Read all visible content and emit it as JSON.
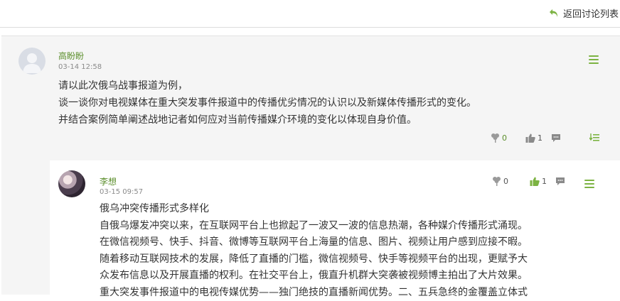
{
  "header": {
    "back_label": "返回讨论列表"
  },
  "post": {
    "author": "高盼盼",
    "time": "03-14 12:58",
    "lines": [
      "请以此次俄乌战事报道为例，",
      "谈一谈你对电视媒体在重大突发事件报道中的传播优劣情况的认识以及新媒体传播形式的变化。",
      "并结合案例简单阐述战地记者如何应对当前传播媒介环境的变化以体现自身价值。"
    ],
    "flower_count": "0",
    "like_count": "1"
  },
  "reply": {
    "author": "李想",
    "time": "03-15 09:57",
    "flower_count": "0",
    "like_count": "1",
    "lines": [
      "俄乌冲突传播形式多样化",
      "自俄乌爆发冲突以来，在互联网平台上也掀起了一波又一波的信息热潮，各种媒介传播形式涌现。",
      "在微信视频号、快手、抖音、微博等互联网平台上海量的信息、图片、视频让用户感到应接不暇。",
      "随着移动互联网技术的发展，降低了直播的门槛，微信视频号、快手等视频平台的出现，更赋予大",
      "众发布信息以及开展直播的权利。在社交平台上，俄直升机群大突袭被视频博主拍出了大片效果。",
      "重大突发事件报道中的电视传媒优势——独门绝技的直播新闻优势。二、五兵急终的金覆盖立体式"
    ]
  },
  "colors": {
    "accent": "#7cb342",
    "author": "#5b8e2b"
  }
}
